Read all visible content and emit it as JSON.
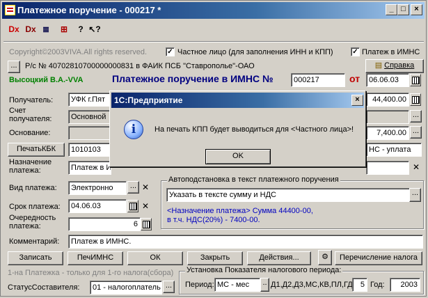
{
  "window": {
    "title": "Платежное поручение - 000217 *",
    "btn_min": "_",
    "btn_max": "□",
    "btn_close": "×"
  },
  "toolbar": [
    "Dx",
    "Dx",
    "≣",
    "⊞",
    "?",
    "↖?"
  ],
  "copyright": "Copyright©2003VIVA.All rights reserved.",
  "checks": {
    "private_label": "Частное лицо (для заполнения ИНН и КПП)",
    "private_checked": true,
    "imns_label": "Платеж в ИМНС",
    "imns_checked": true
  },
  "account_line": "Р/с № 40702810700000000831 в ФАИК ПСБ \"Ставрополье\"-ОАО",
  "help_button": "Справка",
  "user_name": "Высоцкий В.А.-VVA",
  "doc": {
    "heading": "Платежное поручение в ИМНС №",
    "number": "000217",
    "from_label": "от",
    "date": "06.06.03"
  },
  "fields": {
    "recipient_label": "Получатель:",
    "recipient_value": "УФК г.Пят",
    "account_label_1": "Счет",
    "account_label_2": "получателя:",
    "account_value": "Основной",
    "basis_label": "Основание:",
    "kbk_button": "ПечатьКБК",
    "kbk_value": "1010103",
    "purpose_label_1": "Назначение",
    "purpose_label_2": "платежа:",
    "purpose_value": "Платеж в И",
    "amount": "44,400.00",
    "vat": "7,400.00",
    "tax_type": "НС - уплата",
    "pay_type_label": "Вид платежа:",
    "pay_type_value": "Электронно",
    "due_label": "Срок платежа:",
    "due_value": "04.06.03",
    "order_label_1": "Очередность",
    "order_label_2": "платежа:",
    "order_value": "6",
    "comment_label": "Комментарий:",
    "comment_value": "Платеж в ИМНС."
  },
  "autosubst": {
    "title": "Автоподстановка в текст платежного поручения",
    "value": "Указать в тексте сумму и НДС",
    "preview_1": "<Назначение платежа> Сумма 44400-00,",
    "preview_2": "в т.ч. НДС(20%) - 7400-00."
  },
  "buttons": {
    "record": "Записать",
    "print_imns": "ПечИМНС",
    "ok": "ОК",
    "close": "Закрыть",
    "actions": "Действия...",
    "transfer": "Перечисление налога"
  },
  "footer": {
    "note": "1-на Платежка - только для  1-го налога(сбора)",
    "status_label": "СтатусСоставителя:",
    "status_value": "01 - налогоплатель",
    "period_group": "Установка Показателя налогового периода:",
    "period_label": "Период:",
    "period_value": "МС - мес",
    "period_codes": "Д1,Д2,Д3,МС,КВ,ПЛ,ГД",
    "period_num": "5",
    "year_label": "Год:",
    "year_value": "2003"
  },
  "dialog": {
    "title": "1С:Предприятие",
    "message": "На печать КПП будет выводиться для <Частного лица>!",
    "ok": "OK",
    "icon": "info-icon"
  }
}
